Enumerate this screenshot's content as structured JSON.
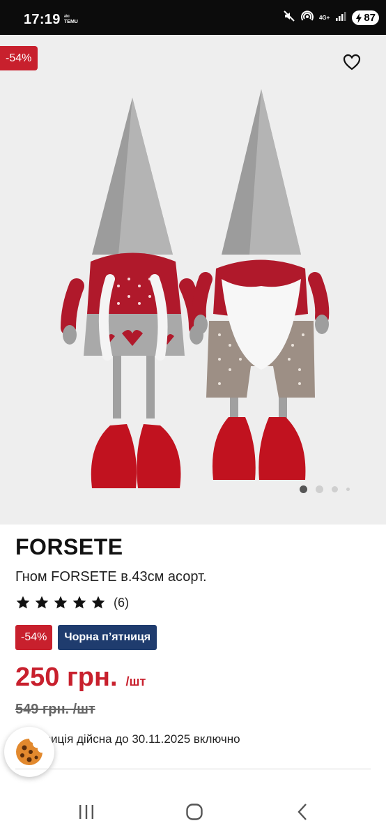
{
  "status_bar": {
    "time": "17:19",
    "small_label": "ᵃᵇᶜ TEMU",
    "network": "4G+",
    "battery": "87"
  },
  "gallery": {
    "discount_tag": "-54%",
    "dots_total": 4,
    "active_index": 0
  },
  "product": {
    "brand": "FORSETE",
    "name": "Гном FORSETE в.43см асорт.",
    "rating_stars": 5,
    "review_count": "(6)",
    "badge_discount": "-54%",
    "badge_event": "Чорна п’ятниця",
    "price": "250 грн.",
    "price_unit": "/шт",
    "old_price": "549 грн. /шт",
    "offer_note": "озиція дійсна до 30.11.2025 включно"
  },
  "colors": {
    "accent_red": "#c8202d",
    "badge_blue": "#1f3c6e"
  }
}
